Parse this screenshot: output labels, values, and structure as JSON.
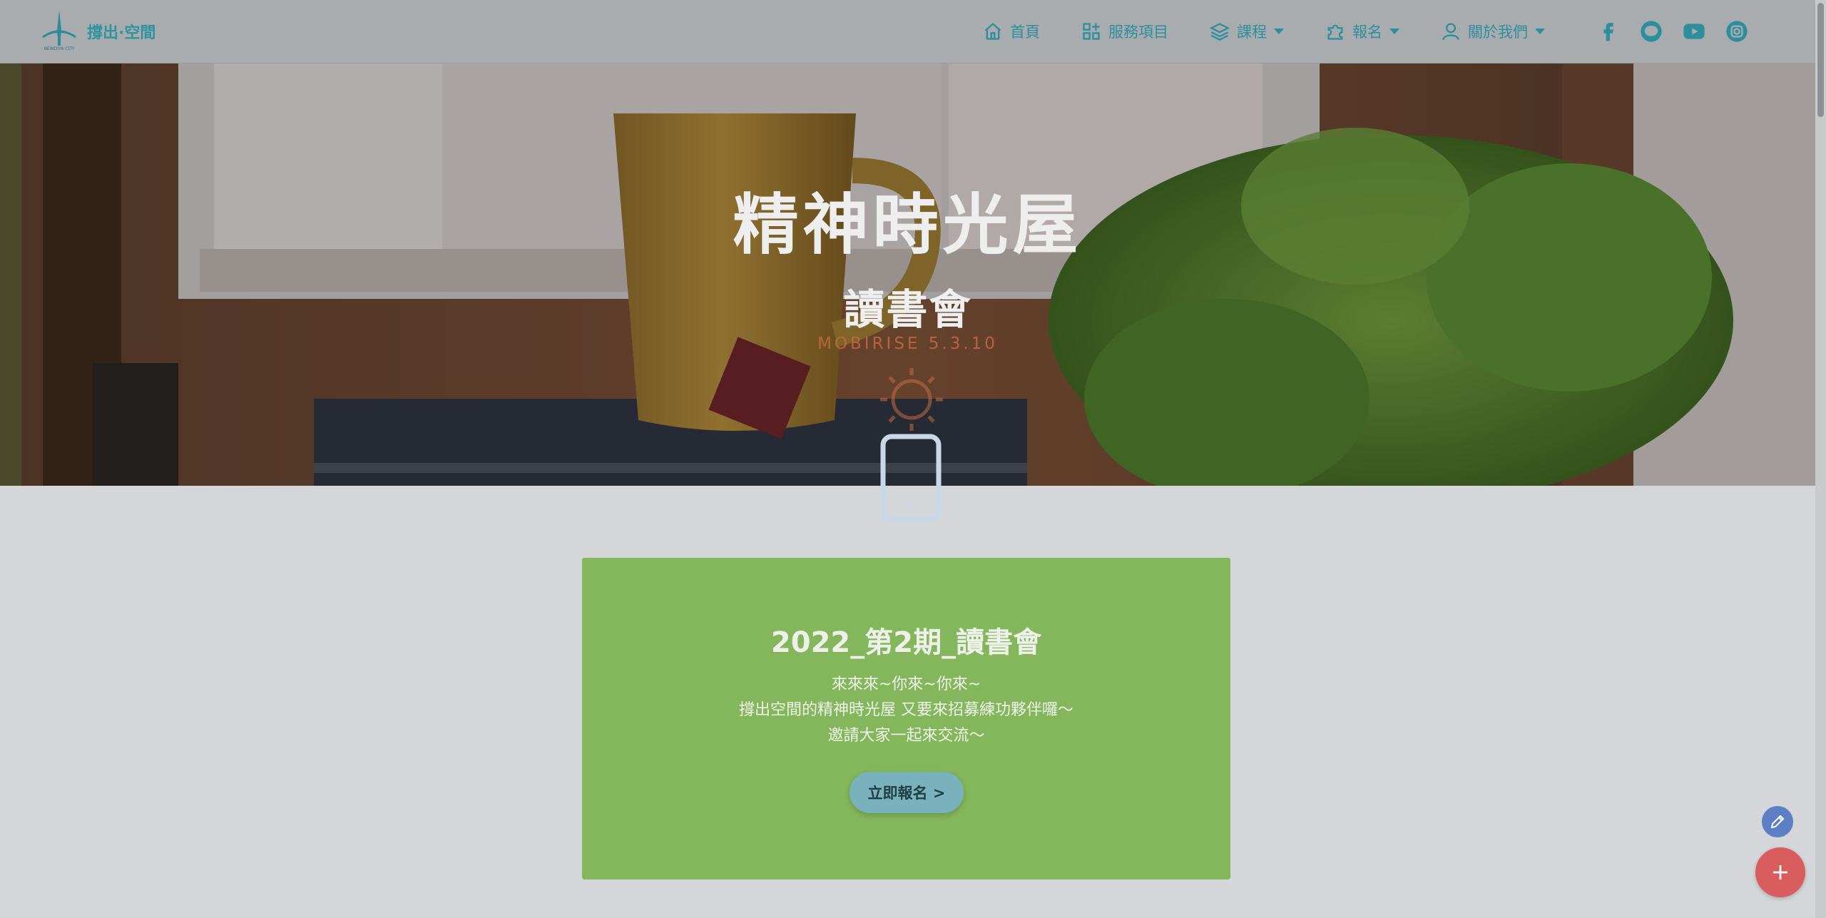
{
  "brand": {
    "name": "撐出·空間",
    "logo_text": "NEWDIYA CITY"
  },
  "nav": {
    "items": [
      {
        "label": "首頁",
        "icon": "home-icon",
        "dropdown": false
      },
      {
        "label": "服務項目",
        "icon": "widgets-icon",
        "dropdown": false
      },
      {
        "label": "課程",
        "icon": "layers-icon",
        "dropdown": true
      },
      {
        "label": "報名",
        "icon": "puzzle-icon",
        "dropdown": true
      },
      {
        "label": "關於我們",
        "icon": "user-icon",
        "dropdown": true
      }
    ],
    "socials": [
      "facebook-icon",
      "line-icon",
      "youtube-icon",
      "instagram-icon"
    ]
  },
  "hero": {
    "title": "精神時光屋",
    "subtitle": "讀書會",
    "watermark": "MOBIRISE 5.3.10"
  },
  "card": {
    "title": "2022_第2期_讀書會",
    "lines": [
      "來來來~你來~你來~",
      "撐出空間的精神時光屋 又要來招募練功夥伴囉～",
      "邀請大家一起來交流～"
    ],
    "button_label": "立即報名 >"
  },
  "colors": {
    "accent": "#2d8f9d",
    "card_bg": "#84b65b",
    "button_bg": "#79b2bd",
    "fab_edit": "#5d80c4",
    "fab_add": "#d95c5e"
  }
}
